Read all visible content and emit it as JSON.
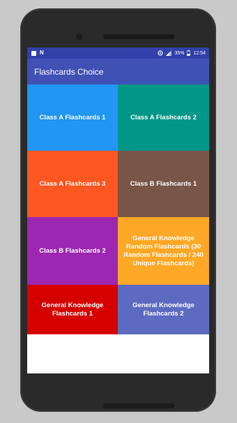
{
  "status_bar": {
    "battery": "35%",
    "time": "12:54",
    "left_icons": [
      "notification-square-icon",
      "n-notification-icon"
    ],
    "right_icons": [
      "data-saver-icon",
      "signal-icon",
      "battery-icon"
    ]
  },
  "app_bar": {
    "title": "Flashcards Choice",
    "color": "#3f51b5"
  },
  "tiles": [
    {
      "label": "Class A Flashcards 1",
      "color": "#2196f3"
    },
    {
      "label": "Class A Flashcards 2",
      "color": "#009688"
    },
    {
      "label": "Class A Flashcards 3",
      "color": "#ff5722"
    },
    {
      "label": "Class B Flashcards 1",
      "color": "#795548"
    },
    {
      "label": "Class B Flashcards 2",
      "color": "#9c27b0"
    },
    {
      "label": "General Knowledge Random Flashcards (30 Random Flashcards / 240 Unique Flashcards)",
      "color": "#ffa726"
    },
    {
      "label": "General Knowledge Flashcards 1",
      "color": "#d50000"
    },
    {
      "label": "General Knowledge Flashcards 2",
      "color": "#5c6bc0"
    }
  ]
}
